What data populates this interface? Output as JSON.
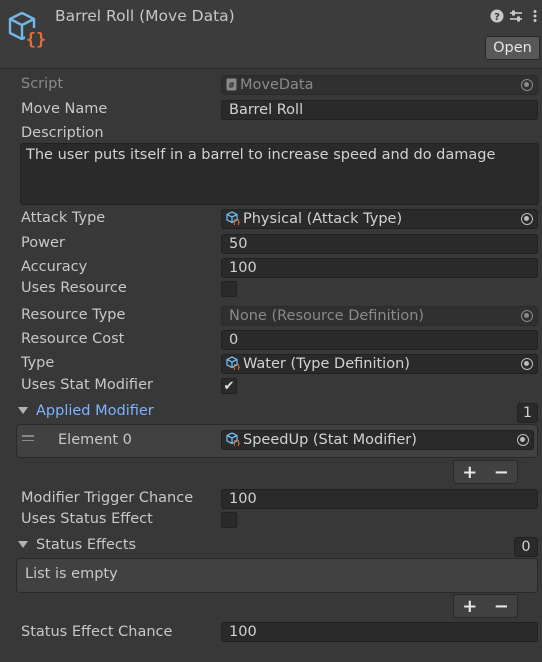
{
  "header": {
    "title": "Barrel Roll (Move Data)",
    "open_label": "Open",
    "icons": [
      "help-icon",
      "presets-icon",
      "more-icon"
    ]
  },
  "fields": {
    "script": {
      "label": "Script",
      "value": "MoveData"
    },
    "move_name": {
      "label": "Move Name",
      "value": "Barrel Roll"
    },
    "description": {
      "label": "Description",
      "value": "The user puts itself in a barrel to increase speed and do damage"
    },
    "attack_type": {
      "label": "Attack Type",
      "value": "Physical (Attack Type)"
    },
    "power": {
      "label": "Power",
      "value": "50"
    },
    "accuracy": {
      "label": "Accuracy",
      "value": "100"
    },
    "uses_resource": {
      "label": "Uses Resource",
      "checked": false
    },
    "resource_type": {
      "label": "Resource Type",
      "value": "None (Resource Definition)"
    },
    "resource_cost": {
      "label": "Resource Cost",
      "value": "0"
    },
    "type": {
      "label": "Type",
      "value": "Water (Type Definition)"
    },
    "uses_stat_modifier": {
      "label": "Uses Stat Modifier",
      "checked": true,
      "mark": "✔"
    },
    "applied_modifier": {
      "label": "Applied Modifier",
      "count": "1",
      "elements": [
        {
          "label": "Element 0",
          "value": "SpeedUp (Stat Modifier)"
        }
      ]
    },
    "modifier_trigger_chance": {
      "label": "Modifier Trigger Chance",
      "value": "100"
    },
    "uses_status_effect": {
      "label": "Uses Status Effect",
      "checked": false
    },
    "status_effects": {
      "label": "Status Effects",
      "count": "0",
      "empty_text": "List is empty"
    },
    "status_effect_chance": {
      "label": "Status Effect Chance",
      "value": "100"
    }
  },
  "list_buttons": {
    "add": "+",
    "remove": "−"
  },
  "colors": {
    "background": "#383838",
    "field": "#2a2a2a",
    "foldout_accent": "#7fb2ff",
    "script_icon_orange": "#e3703a",
    "script_icon_blue": "#6fb8e8"
  }
}
